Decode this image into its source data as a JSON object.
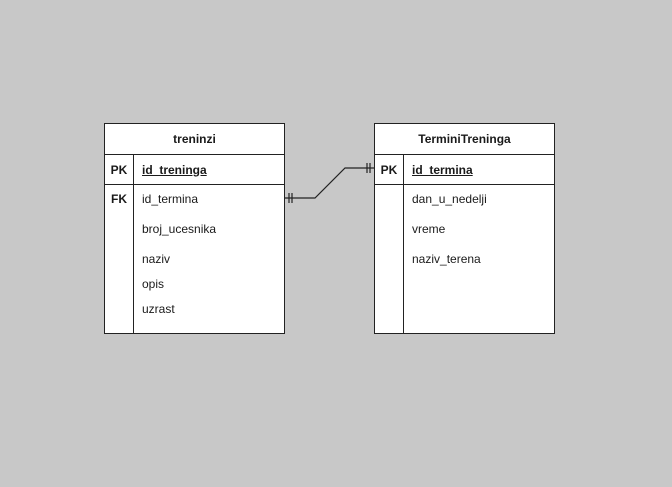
{
  "entities": {
    "treninzi": {
      "name": "treninzi",
      "pk_label": "PK",
      "pk_attr": "id_treninga",
      "fk_label": "FK",
      "attrs": [
        "id_termina",
        "broj_ucesnika",
        "naziv",
        "opis",
        "uzrast"
      ]
    },
    "termini": {
      "name": "TerminiTreninga",
      "pk_label": "PK",
      "pk_attr": "id_termina",
      "attrs": [
        "dan_u_nedelji",
        "vreme",
        "naziv_terena"
      ]
    }
  },
  "relationship": {
    "from": "treninzi.id_termina",
    "to": "TerminiTreninga.id_termina",
    "notation": "one-and-only-one to one-and-only-one"
  },
  "colors": {
    "background": "#c8c8c8",
    "entity_fill": "#ffffff",
    "stroke": "#222222"
  }
}
